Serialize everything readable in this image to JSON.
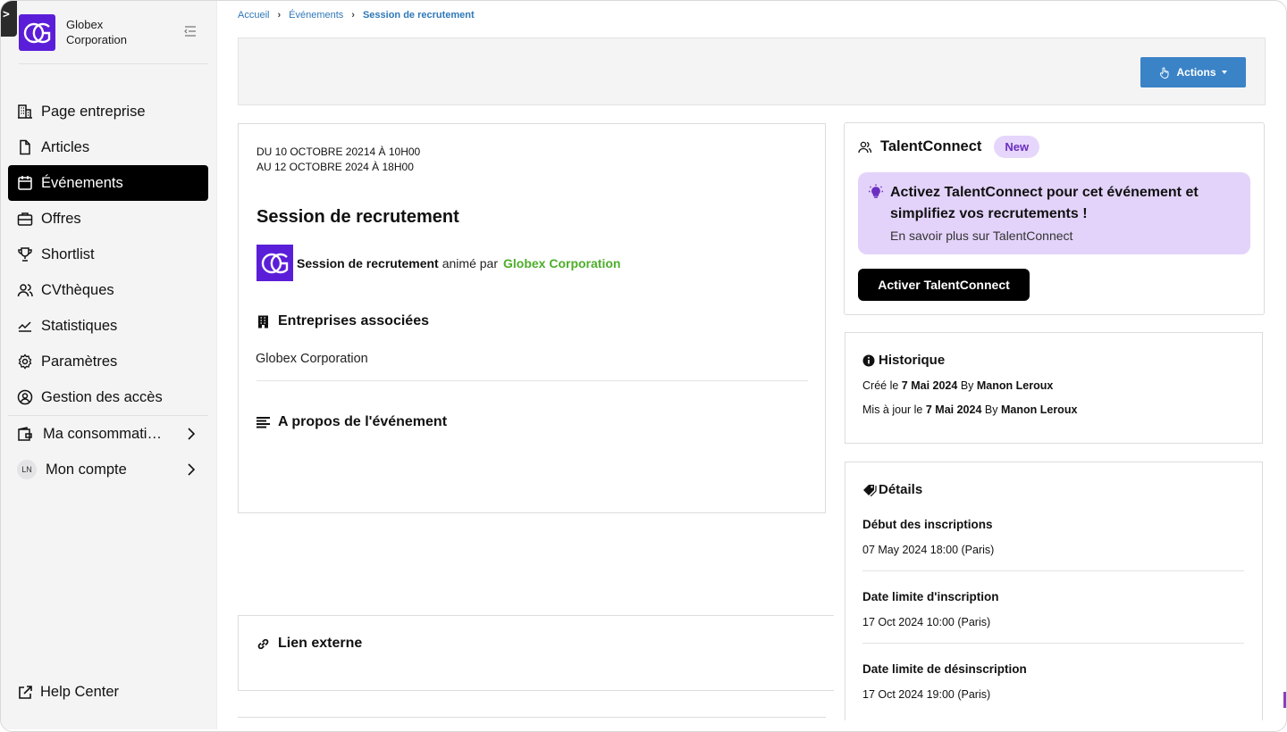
{
  "company": {
    "name": "Globex Corporation"
  },
  "breadcrumb": [
    "Accueil",
    "Événements",
    "Session de recrutement"
  ],
  "sidebar": {
    "items": [
      {
        "label": "Page entreprise",
        "icon": "building-icon"
      },
      {
        "label": "Articles",
        "icon": "document-icon"
      },
      {
        "label": "Événements",
        "icon": "calendar-icon",
        "active": true
      },
      {
        "label": "Offres",
        "icon": "briefcase-icon"
      },
      {
        "label": "Shortlist",
        "icon": "trophy-icon"
      },
      {
        "label": "CVthèques",
        "icon": "users-icon"
      },
      {
        "label": "Statistiques",
        "icon": "chart-line-icon"
      },
      {
        "label": "Paramètres",
        "icon": "gear-icon"
      },
      {
        "label": "Gestion des accès",
        "icon": "user-circle-icon"
      }
    ],
    "consumption": "Ma consommati…",
    "account": {
      "label": "Mon compte",
      "initials": "LN"
    },
    "help": "Help Center"
  },
  "header": {
    "actions_label": "Actions"
  },
  "event": {
    "date_from": "DU 10 OCTOBRE 20214 À 10H00",
    "date_to": "AU 12 OCTOBRE 2024 À 18H00",
    "title": "Session de recrutement",
    "organizer_event": "Session de recrutement",
    "organizer_text": "animé par",
    "organizer_name": "Globex Corporation",
    "assoc_heading": "Entreprises associées",
    "assoc_company": "Globex Corporation",
    "about_heading": "A propos de l'événement",
    "link_heading": "Lien externe"
  },
  "talentconnect": {
    "title": "TalentConnect",
    "badge": "New",
    "promo_text": "Activez TalentConnect pour cet événement et simplifiez vos recrutements !",
    "promo_link": "En savoir plus sur TalentConnect",
    "button": "Activer TalentConnect"
  },
  "history": {
    "title": "Historique",
    "created_prefix": "Créé le",
    "created_date": "7 Mai 2024",
    "by": "By",
    "created_by": "Manon Leroux",
    "updated_prefix": "Mis à jour le",
    "updated_date": "7 Mai 2024",
    "updated_by": "Manon Leroux"
  },
  "details": {
    "title": "Détails",
    "rows": [
      {
        "label": "Début des inscriptions",
        "value": "07 May 2024 18:00 (Paris)"
      },
      {
        "label": "Date limite d'inscription",
        "value": "17 Oct 2024 10:00 (Paris)"
      },
      {
        "label": "Date limite de désinscription",
        "value": "17 Oct 2024 19:00 (Paris)"
      }
    ]
  },
  "colors": {
    "brand_purple": "#5b1ed8",
    "action_blue": "#3b83c7",
    "organizer_green": "#4cae2a",
    "promo_bg": "#e3d3fa"
  }
}
